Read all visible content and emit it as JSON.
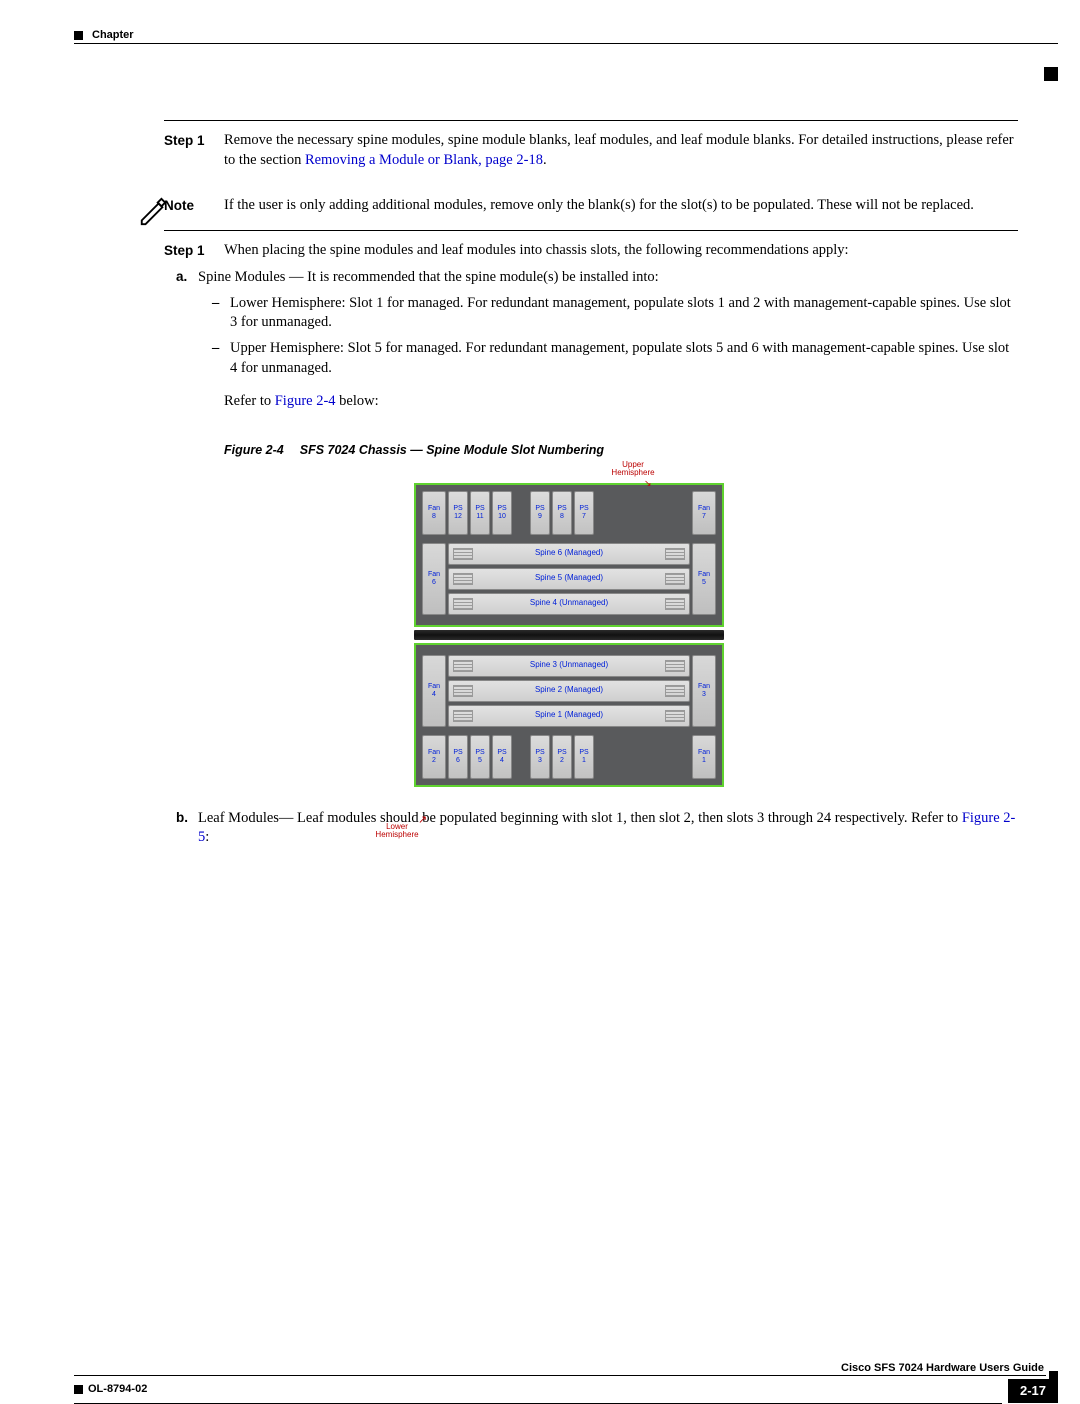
{
  "header": {
    "chapter": "Chapter"
  },
  "steps": {
    "step1_label": "Step 1",
    "step1a_text": "Remove the necessary spine modules, spine module blanks, leaf modules, and leaf module blanks. For detailed instructions, please refer to the section ",
    "step1a_link": "Removing a Module or Blank, page 2-18",
    "step1a_tail": ".",
    "note_label": "Note",
    "note_text": "If the user is only adding additional modules, remove only the blank(s) for the slot(s) to be populated. These will not be replaced.",
    "step1b_label": "Step 1",
    "step1b_text": "When placing the spine modules and leaf modules into chassis slots, the following recommendations apply:",
    "a_marker": "a.",
    "a_text": "Spine Modules — It is recommended that the spine module(s) be installed into:",
    "dash1": "Lower Hemisphere: Slot 1 for managed. For redundant management, populate slots 1 and 2 with management-capable spines. Use slot 3 for unmanaged.",
    "dash2": "Upper Hemisphere: Slot 5 for managed. For redundant management, populate slots 5 and 6 with management-capable spines. Use slot 4 for unmanaged.",
    "refer_pre": "Refer to ",
    "refer_link": "Figure 2-4",
    "refer_post": " below:",
    "b_marker": "b.",
    "b_text_pre": "Leaf Modules— Leaf modules should be populated beginning with slot 1, then slot 2, then slots 3 through 24 respectively. Refer to ",
    "b_link": "Figure 2-5",
    "b_tail": ":"
  },
  "figure": {
    "num": "Figure 2-4",
    "title": "SFS 7024 Chassis — Spine Module Slot Numbering",
    "upper_label": "Upper Hemisphere",
    "lower_label": "Lower Hemisphere",
    "upper": {
      "fans_top": [
        {
          "l": "Fan",
          "n": "8"
        },
        {
          "l": "Fan",
          "n": "7"
        }
      ],
      "ps_top": [
        {
          "l": "PS",
          "n": "12"
        },
        {
          "l": "PS",
          "n": "11"
        },
        {
          "l": "PS",
          "n": "10"
        },
        {
          "l": "PS",
          "n": "9"
        },
        {
          "l": "PS",
          "n": "8"
        },
        {
          "l": "PS",
          "n": "7"
        }
      ],
      "fans_mid": [
        {
          "l": "Fan",
          "n": "6"
        },
        {
          "l": "Fan",
          "n": "5"
        }
      ],
      "spines": [
        "Spine 6 (Managed)",
        "Spine 5 (Managed)",
        "Spine 4 (Unmanaged)"
      ]
    },
    "lower": {
      "fans_mid": [
        {
          "l": "Fan",
          "n": "4"
        },
        {
          "l": "Fan",
          "n": "3"
        }
      ],
      "spines": [
        "Spine 3 (Unmanaged)",
        "Spine 2 (Managed)",
        "Spine 1 (Managed)"
      ],
      "fans_bot": [
        {
          "l": "Fan",
          "n": "2"
        },
        {
          "l": "Fan",
          "n": "1"
        }
      ],
      "ps_bot": [
        {
          "l": "PS",
          "n": "6"
        },
        {
          "l": "PS",
          "n": "5"
        },
        {
          "l": "PS",
          "n": "4"
        },
        {
          "l": "PS",
          "n": "3"
        },
        {
          "l": "PS",
          "n": "2"
        },
        {
          "l": "PS",
          "n": "1"
        }
      ]
    }
  },
  "footer": {
    "guide": "Cisco SFS 7024 Hardware Users Guide",
    "doc": "OL-8794-02",
    "page": "2-17"
  }
}
